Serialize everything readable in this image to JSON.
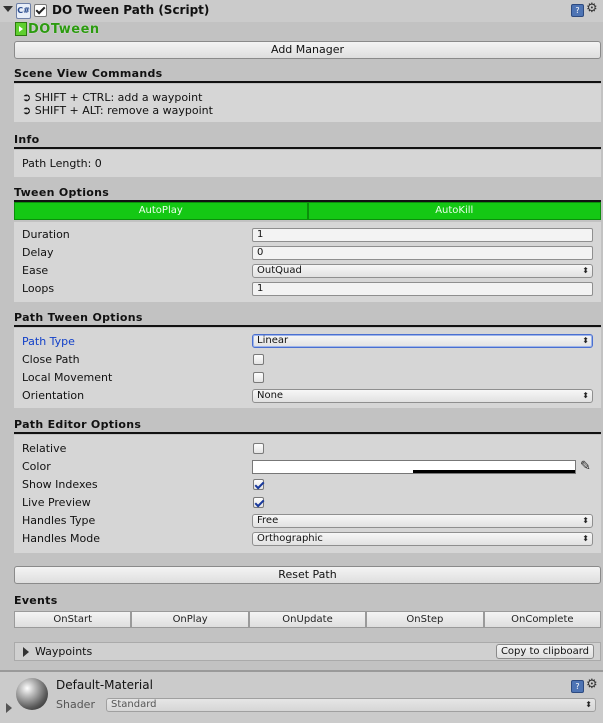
{
  "header": {
    "title": "DO Tween Path (Script)",
    "script_icon": "C#",
    "help_icon": "?",
    "gear_icon": "⚙"
  },
  "logo": {
    "text": "DOTween"
  },
  "add_manager_label": "Add Manager",
  "scene_view": {
    "title": "Scene View Commands",
    "commands": [
      "➲ SHIFT + CTRL: add a waypoint",
      "➲ SHIFT + ALT: remove a waypoint"
    ]
  },
  "info": {
    "title": "Info",
    "path_length": "Path Length: 0"
  },
  "tween_options": {
    "title": "Tween Options",
    "autoplay_label": "AutoPlay",
    "autokill_label": "AutoKill",
    "duration_label": "Duration",
    "duration_value": "1",
    "delay_label": "Delay",
    "delay_value": "0",
    "ease_label": "Ease",
    "ease_value": "OutQuad",
    "loops_label": "Loops",
    "loops_value": "1"
  },
  "path_tween_options": {
    "title": "Path Tween Options",
    "path_type_label": "Path Type",
    "path_type_value": "Linear",
    "close_path_label": "Close Path",
    "close_path_checked": false,
    "local_movement_label": "Local Movement",
    "local_movement_checked": false,
    "orientation_label": "Orientation",
    "orientation_value": "None"
  },
  "path_editor_options": {
    "title": "Path Editor Options",
    "relative_label": "Relative",
    "relative_checked": false,
    "color_label": "Color",
    "color_value": "#ffffff",
    "show_indexes_label": "Show Indexes",
    "show_indexes_checked": true,
    "live_preview_label": "Live Preview",
    "live_preview_checked": true,
    "handles_type_label": "Handles Type",
    "handles_type_value": "Free",
    "handles_mode_label": "Handles Mode",
    "handles_mode_value": "Orthographic"
  },
  "reset_path_label": "Reset Path",
  "events": {
    "title": "Events",
    "buttons": [
      "OnStart",
      "OnPlay",
      "OnUpdate",
      "OnStep",
      "OnComplete"
    ]
  },
  "waypoints": {
    "label": "Waypoints",
    "copy_label": "Copy to clipboard"
  },
  "material": {
    "name": "Default-Material",
    "shader_label": "Shader",
    "shader_value": "Standard"
  },
  "dropdown_arrow": "⬍",
  "colors": {
    "accent_green": "#14c814",
    "focus_blue": "#4a6fd0",
    "label_blue": "#1240c8"
  }
}
